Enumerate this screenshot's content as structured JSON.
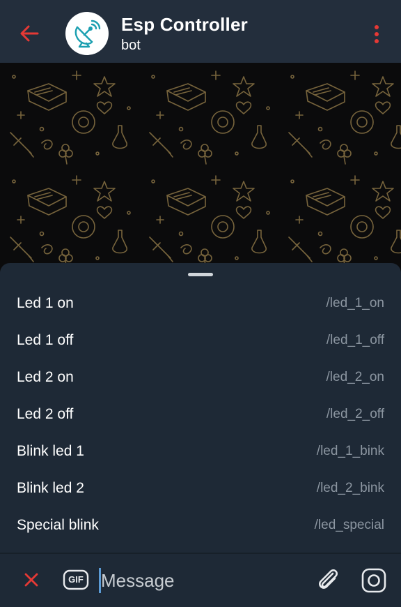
{
  "header": {
    "title": "Esp Controller",
    "subtitle": "bot",
    "back_icon": "arrow-left-icon",
    "menu_icon": "more-vertical-icon",
    "avatar_icon": "satellite-dish-icon",
    "accent_color": "#e53935",
    "avatar_color": "#1a9fb0"
  },
  "commands": [
    {
      "label": "Led 1 on",
      "command": "/led_1_on"
    },
    {
      "label": "Led 1 off",
      "command": "/led_1_off"
    },
    {
      "label": "Led 2 on",
      "command": "/led_2_on"
    },
    {
      "label": "Led 2 off",
      "command": "/led_2_off"
    },
    {
      "label": "Blink led 1",
      "command": "/led_1_bink"
    },
    {
      "label": "Blink led 2",
      "command": "/led_2_bink"
    },
    {
      "label": "Special blink",
      "command": "/led_special"
    }
  ],
  "input": {
    "placeholder": "Message",
    "gif_label": "GIF",
    "close_icon": "close-icon",
    "attach_icon": "paperclip-icon",
    "camera_icon": "instagram-camera-icon"
  },
  "colors": {
    "background": "#1d2733",
    "header": "#232e3c",
    "sheet": "#1e2936",
    "command_text": "#8c96a1",
    "wallpaper_pattern": "#8a7344"
  }
}
